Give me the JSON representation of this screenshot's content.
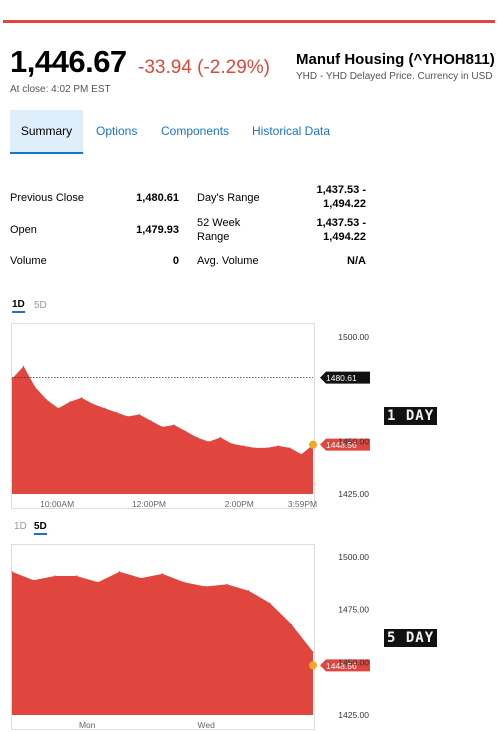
{
  "quote": {
    "price": "1,446.67",
    "change": "-33.94 (-2.29%)",
    "at_close": "At close: 4:02 PM EST",
    "name": "Manuf Housing (^YHOH811)",
    "source": "YHD - YHD Delayed Price. Currency in USD"
  },
  "tabs": [
    "Summary",
    "Options",
    "Components",
    "Historical Data"
  ],
  "stats": {
    "previous_close_label": "Previous Close",
    "previous_close_value": "1,480.61",
    "open_label": "Open",
    "open_value": "1,479.93",
    "volume_label": "Volume",
    "volume_value": "0",
    "days_range_label": "Day's Range",
    "days_range_value_line1": "1,437.53 -",
    "days_range_value_line2": "1,494.22",
    "week52_label_line1": "52 Week",
    "week52_label_line2": "Range",
    "week52_value_line1": "1,437.53 -",
    "week52_value_line2": "1,494.22",
    "avg_volume_label": "Avg. Volume",
    "avg_volume_value": "N/A"
  },
  "chart1": {
    "toggle_1d": "1D",
    "toggle_5d": "5D",
    "yticks": [
      "1500.00",
      "1450.00",
      "1425.00"
    ],
    "xticks": [
      "10:00AM",
      "12:00PM",
      "2:00PM",
      "3:59PM"
    ],
    "prev_close_label": "1480.61",
    "last_label": "1448.56",
    "side_label": "1 DAY"
  },
  "chart2": {
    "toggle_1d": "1D",
    "toggle_5d": "5D",
    "yticks": [
      "1500.00",
      "1475.00",
      "1450.00",
      "1425.00"
    ],
    "xticks": [
      "Mon",
      "Wed"
    ],
    "last_label": "1448.56",
    "side_label": "5 DAY"
  },
  "colors": {
    "accent": "#e0463d",
    "link": "#1a73c8",
    "marker": "#f5a623"
  },
  "chart_data": [
    {
      "type": "area",
      "range": "1D",
      "ylim": [
        1425,
        1500
      ],
      "x": [
        "09:30",
        "09:45",
        "10:00",
        "10:15",
        "10:30",
        "10:45",
        "11:00",
        "11:15",
        "11:30",
        "11:45",
        "12:00",
        "12:15",
        "12:30",
        "12:45",
        "13:00",
        "13:15",
        "13:30",
        "13:45",
        "14:00",
        "14:15",
        "14:30",
        "14:45",
        "15:00",
        "15:15",
        "15:30",
        "15:45",
        "15:59"
      ],
      "values": [
        1480,
        1486,
        1476,
        1470,
        1466,
        1469,
        1471,
        1468,
        1466,
        1464,
        1462,
        1463,
        1460,
        1457,
        1458,
        1455,
        1452,
        1450,
        1452,
        1449,
        1448,
        1447,
        1447,
        1448,
        1447,
        1444,
        1448.56
      ],
      "previous_close": 1480.61,
      "last": 1448.56,
      "xticks": [
        "10:00AM",
        "12:00PM",
        "2:00PM",
        "3:59PM"
      ],
      "yticks": [
        1500,
        1450,
        1425
      ]
    },
    {
      "type": "area",
      "range": "5D",
      "ylim": [
        1425,
        1500
      ],
      "x": [
        "D1-a",
        "D1-b",
        "D1-c",
        "D2-a",
        "D2-b",
        "D2-c",
        "D3-a",
        "D3-b",
        "D3-c",
        "D4-a",
        "D4-b",
        "D4-c",
        "D5-a",
        "D5-b",
        "D5-c"
      ],
      "values": [
        1493,
        1489,
        1491,
        1491,
        1488,
        1493,
        1490,
        1492,
        1488,
        1486,
        1487,
        1484,
        1478,
        1468,
        1455
      ],
      "last": 1448.56,
      "xticks": [
        "Mon",
        "Wed"
      ],
      "yticks": [
        1500,
        1475,
        1450,
        1425
      ]
    }
  ]
}
